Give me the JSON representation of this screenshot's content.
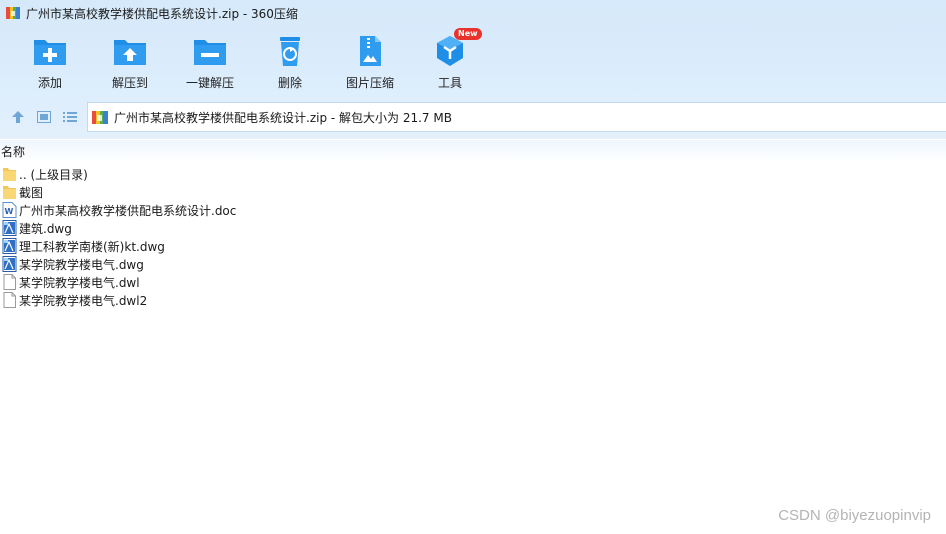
{
  "window": {
    "title": "广州市某高校教学楼供配电系统设计.zip - 360压缩"
  },
  "toolbar": {
    "items": [
      {
        "label": "添加",
        "icon": "add-icon"
      },
      {
        "label": "解压到",
        "icon": "extract-to-icon"
      },
      {
        "label": "一键解压",
        "icon": "one-click-extract-icon"
      },
      {
        "label": "删除",
        "icon": "delete-icon"
      },
      {
        "label": "图片压缩",
        "icon": "image-compress-icon"
      },
      {
        "label": "工具",
        "icon": "tools-icon",
        "badge": "New"
      }
    ]
  },
  "address": {
    "text": "广州市某高校教学楼供配电系统设计.zip - 解包大小为 21.7 MB"
  },
  "list": {
    "column_name": "名称",
    "files": [
      {
        "name": ".. (上级目录)",
        "type": "folder"
      },
      {
        "name": "截图",
        "type": "folder"
      },
      {
        "name": "广州市某高校教学楼供配电系统设计.doc",
        "type": "doc"
      },
      {
        "name": "建筑.dwg",
        "type": "dwg"
      },
      {
        "name": "理工科教学南楼(新)kt.dwg",
        "type": "dwg"
      },
      {
        "name": "某学院教学楼电气.dwg",
        "type": "dwg"
      },
      {
        "name": "某学院教学楼电气.dwl",
        "type": "blank"
      },
      {
        "name": "某学院教学楼电气.dwl2",
        "type": "blank"
      }
    ]
  },
  "watermark": "CSDN @biyezuopinvip",
  "colors": {
    "accent": "#1e8ee6",
    "badge": "#e8322b",
    "toolbar_bg": "#d9ebfb"
  }
}
